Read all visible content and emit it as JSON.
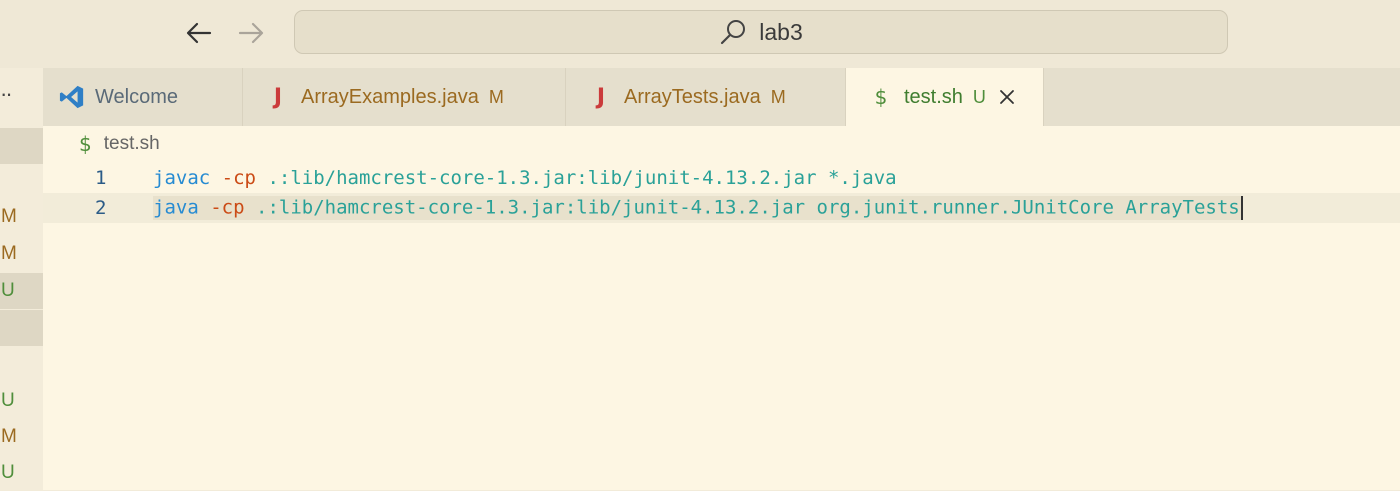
{
  "search": {
    "text": "lab3"
  },
  "sidebar": {
    "more": "··",
    "statuses": [
      "M",
      "M",
      "U",
      "U",
      "M",
      "U"
    ]
  },
  "tabs": [
    {
      "label": "Welcome",
      "icon": "vscode-logo-icon",
      "status": ""
    },
    {
      "label": "ArrayExamples.java",
      "icon": "java-file-icon",
      "status": "M"
    },
    {
      "label": "ArrayTests.java",
      "icon": "java-file-icon",
      "status": "M"
    },
    {
      "label": "test.sh",
      "icon": "shell-file-icon",
      "status": "U",
      "active": true
    }
  ],
  "breadcrumb": {
    "file": "test.sh"
  },
  "editor": {
    "lines": [
      {
        "number": "1",
        "cmd": "javac",
        "flag": "-cp",
        "args": ".:lib/hamcrest-core-1.3.jar:lib/junit-4.13.2.jar *.java"
      },
      {
        "number": "2",
        "cmd": "java",
        "flag": "-cp",
        "args": ".:lib/hamcrest-core-1.3.jar:lib/junit-4.13.2.jar org.junit.runner.JUnitCore ArrayTests"
      }
    ]
  },
  "colors": {
    "modified": "#9b6a20",
    "untracked": "#4f8e3b",
    "command": "#268bd2",
    "flag": "#cb4b16",
    "argument": "#2aa198"
  }
}
